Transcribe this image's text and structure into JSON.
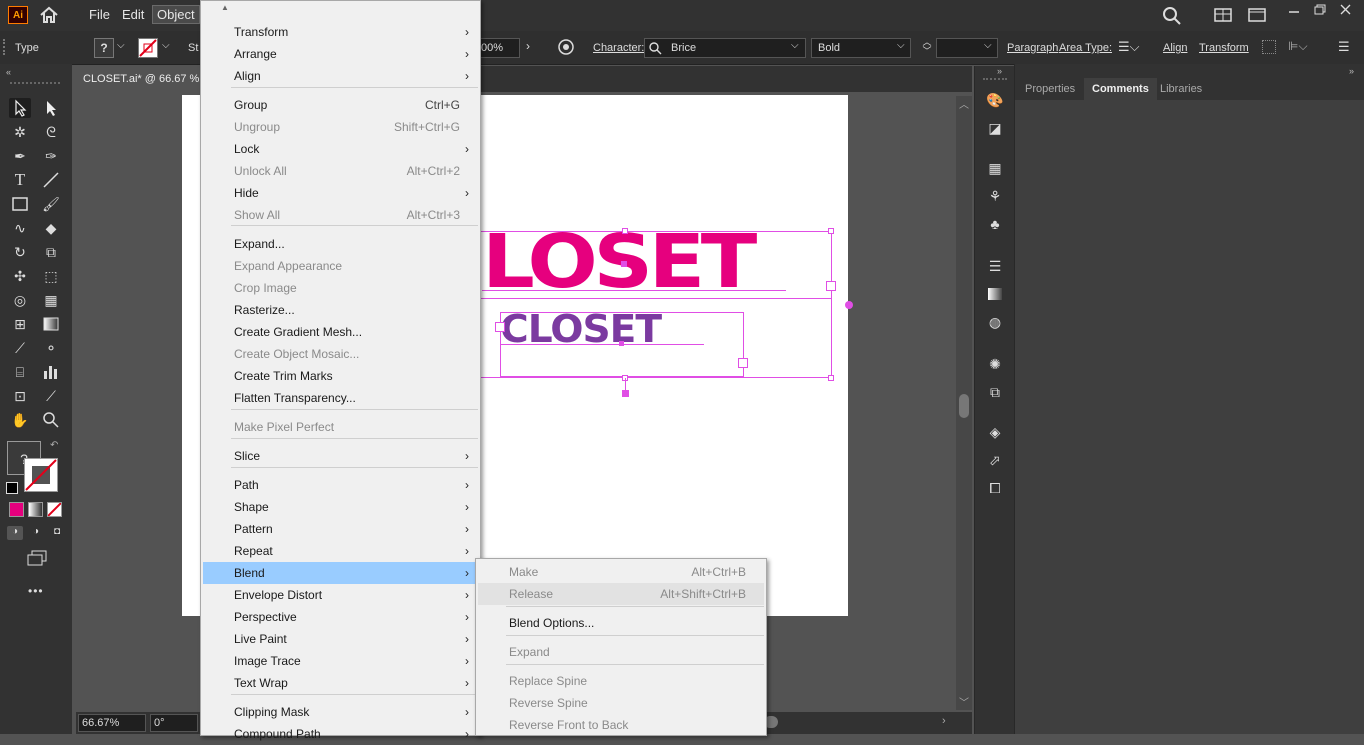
{
  "app": {
    "logo": "Ai",
    "home_icon": "home-icon"
  },
  "menubar": {
    "items": [
      "File",
      "Edit",
      "Object"
    ]
  },
  "controlbar": {
    "mode": "Type",
    "fill_label": "?",
    "stroke_partial": "St",
    "opacity_value": "00%",
    "character_label": "Character:",
    "font_family": "Brice",
    "font_style": "Bold",
    "paragraph_label": "Paragraph",
    "area_type_label": "Area Type:",
    "align_label": "Align",
    "transform_label": "Transform"
  },
  "document": {
    "tab_title": "CLOSET.ai* @ 66.67 %"
  },
  "canvas": {
    "text_large": "LOSET",
    "text_small": "CLOSET",
    "color_large": "#e6007e",
    "color_small": "#7b3aa0"
  },
  "status": {
    "zoom": "66.67%",
    "rotation": "0°"
  },
  "right_panel": {
    "tabs": [
      "Properties",
      "Comments",
      "Libraries"
    ],
    "active_tab": "Comments"
  },
  "tools": {
    "fill_question": "?",
    "more": "•••"
  },
  "object_menu": {
    "items": [
      {
        "label": "Transform",
        "shortcut": "",
        "submenu": true,
        "disabled": false
      },
      {
        "label": "Arrange",
        "shortcut": "",
        "submenu": true,
        "disabled": false
      },
      {
        "label": "Align",
        "shortcut": "",
        "submenu": true,
        "disabled": false
      },
      {
        "label": "Group",
        "shortcut": "Ctrl+G",
        "submenu": false,
        "disabled": false
      },
      {
        "label": "Ungroup",
        "shortcut": "Shift+Ctrl+G",
        "submenu": false,
        "disabled": true
      },
      {
        "label": "Lock",
        "shortcut": "",
        "submenu": true,
        "disabled": false
      },
      {
        "label": "Unlock All",
        "shortcut": "Alt+Ctrl+2",
        "submenu": false,
        "disabled": true
      },
      {
        "label": "Hide",
        "shortcut": "",
        "submenu": true,
        "disabled": false
      },
      {
        "label": "Show All",
        "shortcut": "Alt+Ctrl+3",
        "submenu": false,
        "disabled": true
      },
      {
        "label": "Expand...",
        "shortcut": "",
        "submenu": false,
        "disabled": false
      },
      {
        "label": "Expand Appearance",
        "shortcut": "",
        "submenu": false,
        "disabled": true
      },
      {
        "label": "Crop Image",
        "shortcut": "",
        "submenu": false,
        "disabled": true
      },
      {
        "label": "Rasterize...",
        "shortcut": "",
        "submenu": false,
        "disabled": false
      },
      {
        "label": "Create Gradient Mesh...",
        "shortcut": "",
        "submenu": false,
        "disabled": false
      },
      {
        "label": "Create Object Mosaic...",
        "shortcut": "",
        "submenu": false,
        "disabled": true
      },
      {
        "label": "Create Trim Marks",
        "shortcut": "",
        "submenu": false,
        "disabled": false
      },
      {
        "label": "Flatten Transparency...",
        "shortcut": "",
        "submenu": false,
        "disabled": false
      },
      {
        "label": "Make Pixel Perfect",
        "shortcut": "",
        "submenu": false,
        "disabled": true
      },
      {
        "label": "Slice",
        "shortcut": "",
        "submenu": true,
        "disabled": false
      },
      {
        "label": "Path",
        "shortcut": "",
        "submenu": true,
        "disabled": false
      },
      {
        "label": "Shape",
        "shortcut": "",
        "submenu": true,
        "disabled": false
      },
      {
        "label": "Pattern",
        "shortcut": "",
        "submenu": true,
        "disabled": false
      },
      {
        "label": "Repeat",
        "shortcut": "",
        "submenu": true,
        "disabled": false
      },
      {
        "label": "Blend",
        "shortcut": "",
        "submenu": true,
        "disabled": false,
        "highlighted": true
      },
      {
        "label": "Envelope Distort",
        "shortcut": "",
        "submenu": true,
        "disabled": false
      },
      {
        "label": "Perspective",
        "shortcut": "",
        "submenu": true,
        "disabled": false
      },
      {
        "label": "Live Paint",
        "shortcut": "",
        "submenu": true,
        "disabled": false
      },
      {
        "label": "Image Trace",
        "shortcut": "",
        "submenu": true,
        "disabled": false
      },
      {
        "label": "Text Wrap",
        "shortcut": "",
        "submenu": true,
        "disabled": false
      },
      {
        "label": "Clipping Mask",
        "shortcut": "",
        "submenu": true,
        "disabled": false
      },
      {
        "label": "Compound Path",
        "shortcut": "",
        "submenu": true,
        "disabled": false
      }
    ]
  },
  "blend_menu": {
    "items": [
      {
        "label": "Make",
        "shortcut": "Alt+Ctrl+B",
        "disabled": true
      },
      {
        "label": "Release",
        "shortcut": "Alt+Shift+Ctrl+B",
        "disabled": true,
        "hover": true
      },
      {
        "label": "Blend Options...",
        "shortcut": "",
        "disabled": false
      },
      {
        "label": "Expand",
        "shortcut": "",
        "disabled": true
      },
      {
        "label": "Replace Spine",
        "shortcut": "",
        "disabled": true
      },
      {
        "label": "Reverse Spine",
        "shortcut": "",
        "disabled": true
      },
      {
        "label": "Reverse Front to Back",
        "shortcut": "",
        "disabled": true
      }
    ]
  },
  "colors": {
    "menu_highlight": "#99ccff",
    "selection": "#e04ee5"
  }
}
